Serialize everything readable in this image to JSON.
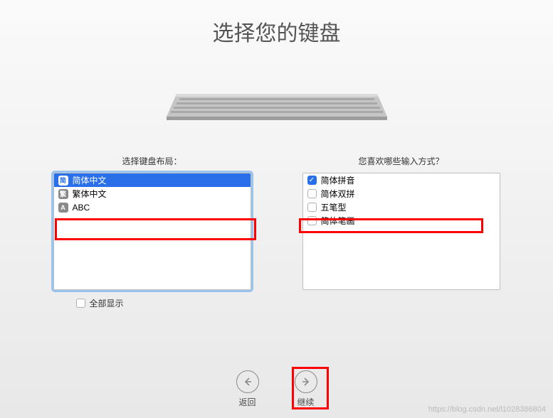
{
  "title": "选择您的键盘",
  "left": {
    "label": "选择键盘布局：",
    "items": [
      {
        "badge": "简",
        "badgeClass": "badge-blue",
        "text": "简体中文",
        "selected": true
      },
      {
        "badge": "繁",
        "badgeClass": "badge-gray",
        "text": "繁体中文",
        "selected": false
      },
      {
        "badge": "A",
        "badgeClass": "badge-gray",
        "text": "ABC",
        "selected": false
      }
    ],
    "showAll": "全部显示"
  },
  "right": {
    "label": "您喜欢哪些输入方式？",
    "items": [
      {
        "text": "简体拼音",
        "checked": true
      },
      {
        "text": "简体双拼",
        "checked": false
      },
      {
        "text": "五笔型",
        "checked": false
      },
      {
        "text": "简体笔画",
        "checked": false
      }
    ]
  },
  "footer": {
    "back": "返回",
    "continue": "继续"
  },
  "watermark": "https://blog.csdn.net/l1028386804"
}
